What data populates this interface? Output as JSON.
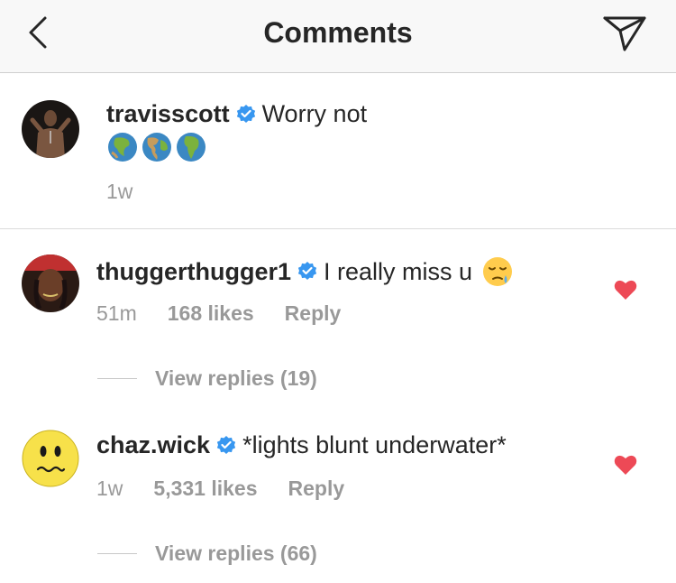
{
  "header": {
    "title": "Comments"
  },
  "caption": {
    "username": "travisscott",
    "text": "Worry not",
    "emoji_row": [
      "globe-asia-icon",
      "globe-americas-icon",
      "globe-africa-icon"
    ],
    "time": "1w"
  },
  "comments": [
    {
      "username": "thuggerthugger1",
      "text": "I really miss u",
      "emoji": "sleepy-face-icon",
      "time": "51m",
      "likes": "168 likes",
      "reply_label": "Reply",
      "view_replies": "View replies (19)"
    },
    {
      "username": "chaz.wick",
      "text": "*lights blunt underwater*",
      "time": "1w",
      "likes": "5,331 likes",
      "reply_label": "Reply",
      "view_replies": "View replies (66)"
    }
  ],
  "colors": {
    "verified": "#3897f0",
    "heart": "#ed4956",
    "muted": "#999999"
  }
}
